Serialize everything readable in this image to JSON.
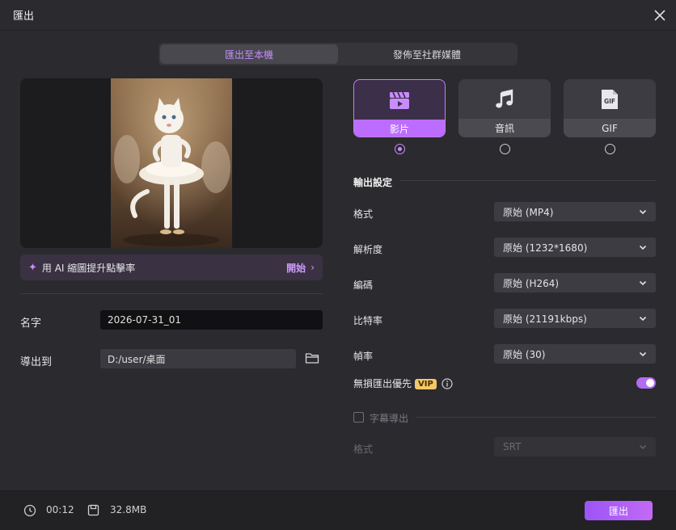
{
  "window": {
    "title": "匯出"
  },
  "tabs": [
    {
      "label": "匯出至本機",
      "active": true
    },
    {
      "label": "發佈至社群媒體",
      "active": false
    }
  ],
  "ai_banner": {
    "label": "用 AI 縮圖提升點擊率",
    "action": "開始"
  },
  "name_field": {
    "label": "名字",
    "value": "2026-07-31_01"
  },
  "export_path": {
    "label": "導出到",
    "value": "D:/user/桌面"
  },
  "types": [
    {
      "label": "影片",
      "icon": "video-clapper-icon",
      "selected": true
    },
    {
      "label": "音訊",
      "icon": "music-note-icon",
      "selected": false
    },
    {
      "label": "GIF",
      "icon": "gif-file-icon",
      "selected": false
    }
  ],
  "settings": {
    "title": "輸出設定",
    "rows": [
      {
        "label": "格式",
        "value": "原始 (MP4)"
      },
      {
        "label": "解析度",
        "value": "原始 (1232*1680)"
      },
      {
        "label": "編碼",
        "value": "原始 (H264)"
      },
      {
        "label": "比特率",
        "value": "原始 (21191kbps)"
      },
      {
        "label": "幀率",
        "value": "原始 (30)"
      }
    ],
    "lossless": {
      "label": "無損匯出優先",
      "badge": "VIP",
      "enabled": true
    }
  },
  "subtitle": {
    "label": "字幕導出",
    "checked": false,
    "format_label": "格式",
    "format_value": "SRT"
  },
  "footer": {
    "duration": "00:12",
    "size": "32.8MB",
    "export_label": "匯出"
  },
  "colors": {
    "accent": "#c98cff",
    "background": "#2b2b2f",
    "footer": "#222225"
  }
}
